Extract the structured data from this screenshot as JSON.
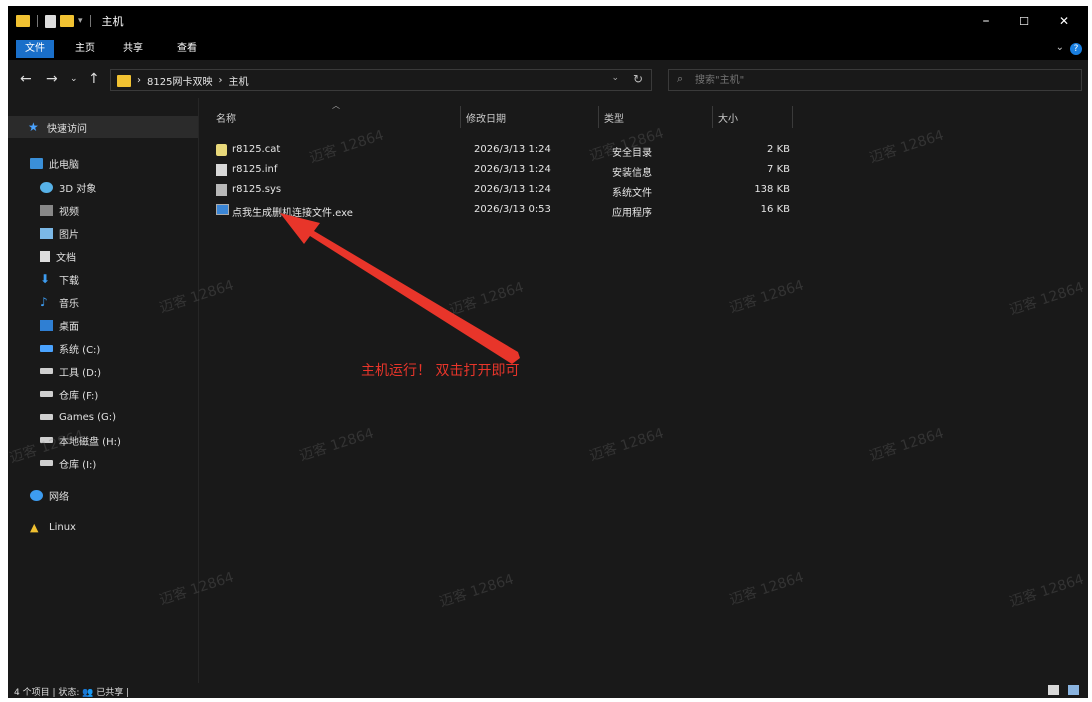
{
  "window": {
    "title": "主机",
    "controls": {
      "minimize": "–",
      "maximize": "☐",
      "close": "✕"
    }
  },
  "ribbon": {
    "tabs": [
      "文件",
      "主页",
      "共享",
      "查看"
    ],
    "help": "?",
    "collapse": "⌄"
  },
  "nav": {
    "back": "←",
    "forward": "→",
    "recent": "⌄",
    "up": "↑"
  },
  "address": {
    "crumbs": [
      "8125网卡双映",
      "主机"
    ],
    "separator": "›",
    "dropdown": "⌄",
    "refresh": "↻"
  },
  "search": {
    "placeholder": "搜索\"主机\"",
    "icon": "⌕"
  },
  "sidebar": {
    "items": [
      {
        "label": "快速访问",
        "icon": "star-icon"
      },
      {
        "label": "此电脑",
        "icon": "computer-icon"
      },
      {
        "label": "3D 对象",
        "icon": "3d-objects-icon"
      },
      {
        "label": "视频",
        "icon": "video-icon"
      },
      {
        "label": "图片",
        "icon": "picture-icon"
      },
      {
        "label": "文档",
        "icon": "document-icon"
      },
      {
        "label": "下载",
        "icon": "download-icon"
      },
      {
        "label": "音乐",
        "icon": "music-icon"
      },
      {
        "label": "桌面",
        "icon": "desktop-icon"
      },
      {
        "label": "系统 (C:)",
        "icon": "system-drive-icon"
      },
      {
        "label": "工具 (D:)",
        "icon": "drive-icon"
      },
      {
        "label": "仓库 (F:)",
        "icon": "drive-icon"
      },
      {
        "label": "Games (G:)",
        "icon": "drive-icon"
      },
      {
        "label": "本地磁盘 (H:)",
        "icon": "drive-icon"
      },
      {
        "label": "仓库 (I:)",
        "icon": "drive-icon"
      },
      {
        "label": "网络",
        "icon": "network-icon"
      },
      {
        "label": "Linux",
        "icon": "linux-icon"
      }
    ]
  },
  "columns": {
    "name": "名称",
    "date": "修改日期",
    "type": "类型",
    "size": "大小"
  },
  "files": [
    {
      "name": "r8125.cat",
      "date": "2026/3/13 1:24",
      "type": "安全目录",
      "size": "2 KB",
      "icon": "catalog-file-icon"
    },
    {
      "name": "r8125.inf",
      "date": "2026/3/13 1:24",
      "type": "安装信息",
      "size": "7 KB",
      "icon": "setup-info-file-icon"
    },
    {
      "name": "r8125.sys",
      "date": "2026/3/13 1:24",
      "type": "系统文件",
      "size": "138 KB",
      "icon": "system-file-icon"
    },
    {
      "name": "点我生成删机连接文件.exe",
      "date": "2026/3/13 0:53",
      "type": "应用程序",
      "size": "16 KB",
      "icon": "exe-file-icon"
    }
  ],
  "annotation": {
    "text": "主机运行！ 双击打开即可",
    "color": "#e8352a"
  },
  "watermark": "迈客 12864",
  "status": {
    "text": "4 个项目  |  状态: 👥 已共享  |"
  },
  "colors": {
    "accent": "#1a6fc9",
    "background": "#191919",
    "titlebar": "#000000"
  }
}
